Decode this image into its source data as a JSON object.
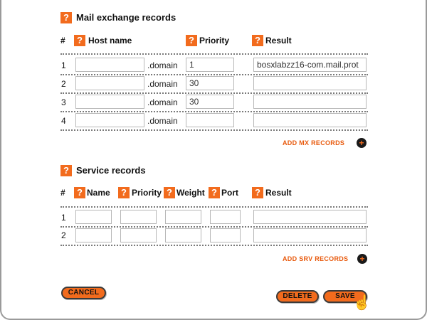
{
  "mx": {
    "title": "Mail exchange records",
    "headers": {
      "num": "#",
      "host": "Host name",
      "priority": "Priority",
      "result": "Result"
    },
    "rows": [
      {
        "num": "1",
        "host": "",
        "suffix": ".domain",
        "priority": "1",
        "result": "bosxlabzz16-com.mail.prot"
      },
      {
        "num": "2",
        "host": "",
        "suffix": ".domain",
        "priority": "30",
        "result": ""
      },
      {
        "num": "3",
        "host": "",
        "suffix": ".domain",
        "priority": "30",
        "result": ""
      },
      {
        "num": "4",
        "host": "",
        "suffix": ".domain",
        "priority": "",
        "result": ""
      }
    ],
    "add_label": "ADD MX RECORDS"
  },
  "srv": {
    "title": "Service records",
    "headers": {
      "num": "#",
      "name": "Name",
      "priority": "Priority",
      "weight": "Weight",
      "port": "Port",
      "result": "Result"
    },
    "rows": [
      {
        "num": "1",
        "name": "",
        "priority": "",
        "weight": "",
        "port": "",
        "result": ""
      },
      {
        "num": "2",
        "name": "",
        "priority": "",
        "weight": "",
        "port": "",
        "result": ""
      }
    ],
    "add_label": "ADD SRV RECORDS"
  },
  "icons": {
    "help": "?",
    "plus": "+",
    "cursor": "hand-pointer"
  },
  "buttons": {
    "cancel": "CANCEL",
    "delete": "DELETE",
    "save": "SAVE"
  },
  "colors": {
    "accent": "#f26b1d",
    "link": "#e8590c"
  }
}
